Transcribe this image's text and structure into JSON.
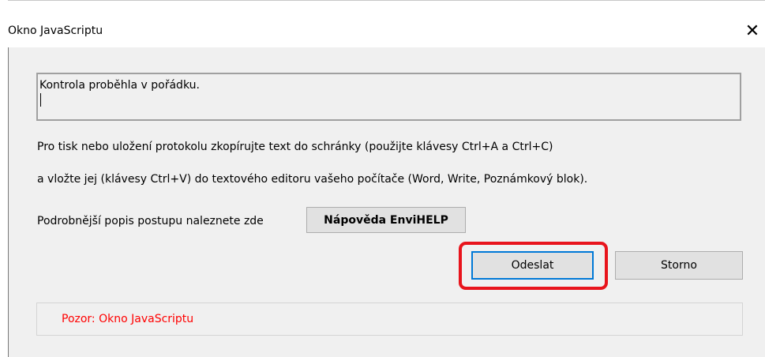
{
  "window": {
    "title": "Okno JavaScriptu",
    "close_symbol": "✕"
  },
  "message": {
    "text": "Kontrola proběhla v pořádku."
  },
  "instructions": {
    "line1": "Pro tisk nebo uložení protokolu zkopírujte text do schránky (použijte klávesy Ctrl+A a Ctrl+C)",
    "line2": "a vložte jej (klávesy Ctrl+V) do textového editoru vašeho počítače (Word, Write, Poznámkový blok)."
  },
  "help": {
    "label": "Podrobnější popis postupu naleznete zde",
    "button_label": "Nápověda EnviHELP"
  },
  "actions": {
    "send_label": "Odeslat",
    "cancel_label": "Storno"
  },
  "warning": {
    "text": "Pozor: Okno JavaScriptu",
    "color": "#ff0000"
  },
  "colors": {
    "highlight": "#e8141c",
    "focus_border": "#0078d7",
    "dialog_background": "#f0f0f0"
  }
}
